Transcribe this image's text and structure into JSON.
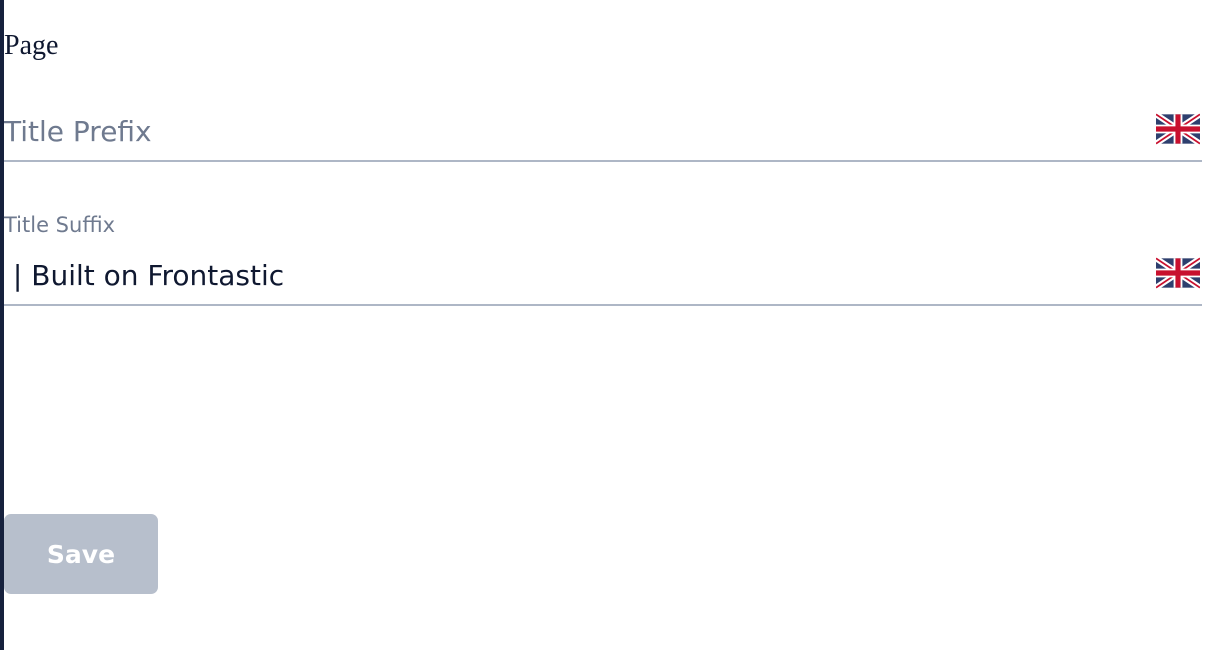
{
  "section": {
    "title": "Page"
  },
  "fields": {
    "title_prefix": {
      "placeholder": "Title Prefix",
      "value": "",
      "locale_flag_icon": "uk-flag-icon"
    },
    "title_suffix": {
      "label": "Title Suffix",
      "value": " | Built on Frontastic",
      "locale_flag_icon": "uk-flag-icon"
    }
  },
  "actions": {
    "save_label": "Save",
    "save_enabled": false
  },
  "colors": {
    "text_primary": "#0f1830",
    "text_muted": "#6f7a8f",
    "field_underline": "#aeb7c6",
    "button_disabled": "#b7bfcc",
    "left_edge": "#16213d",
    "flag_blue": "#2e3f6e",
    "flag_red": "#c8102e"
  }
}
